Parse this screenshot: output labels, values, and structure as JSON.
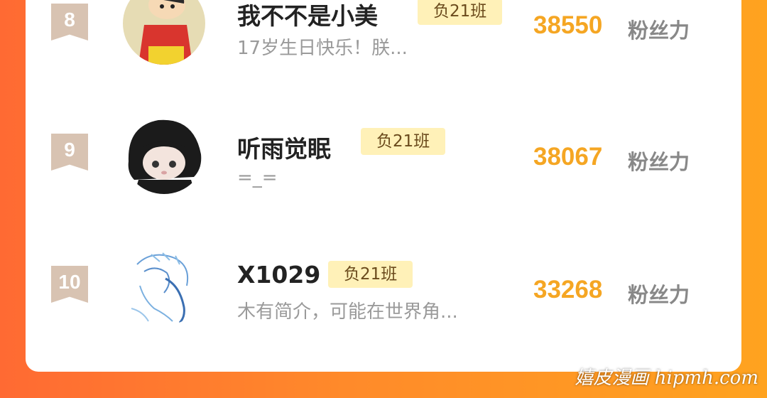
{
  "rows": [
    {
      "rank": "8",
      "name": "我不不是小美",
      "tag": "负21班",
      "bio": "17岁生日快乐！朕...",
      "score": "38550",
      "unit": "粉丝力"
    },
    {
      "rank": "9",
      "name": "听雨觉眠",
      "tag": "负21班",
      "bio": "=_=",
      "score": "38067",
      "unit": "粉丝力"
    },
    {
      "rank": "10",
      "name": "X1029",
      "tag": "负21班",
      "bio": "木有简介，可能在世界角...",
      "score": "33268",
      "unit": "粉丝力"
    }
  ],
  "watermark": "嬉皮漫画 hipmh.com",
  "colors": {
    "score": "#f5a623",
    "tag_bg": "#fff1b8",
    "badge": "#d8c3b2"
  }
}
